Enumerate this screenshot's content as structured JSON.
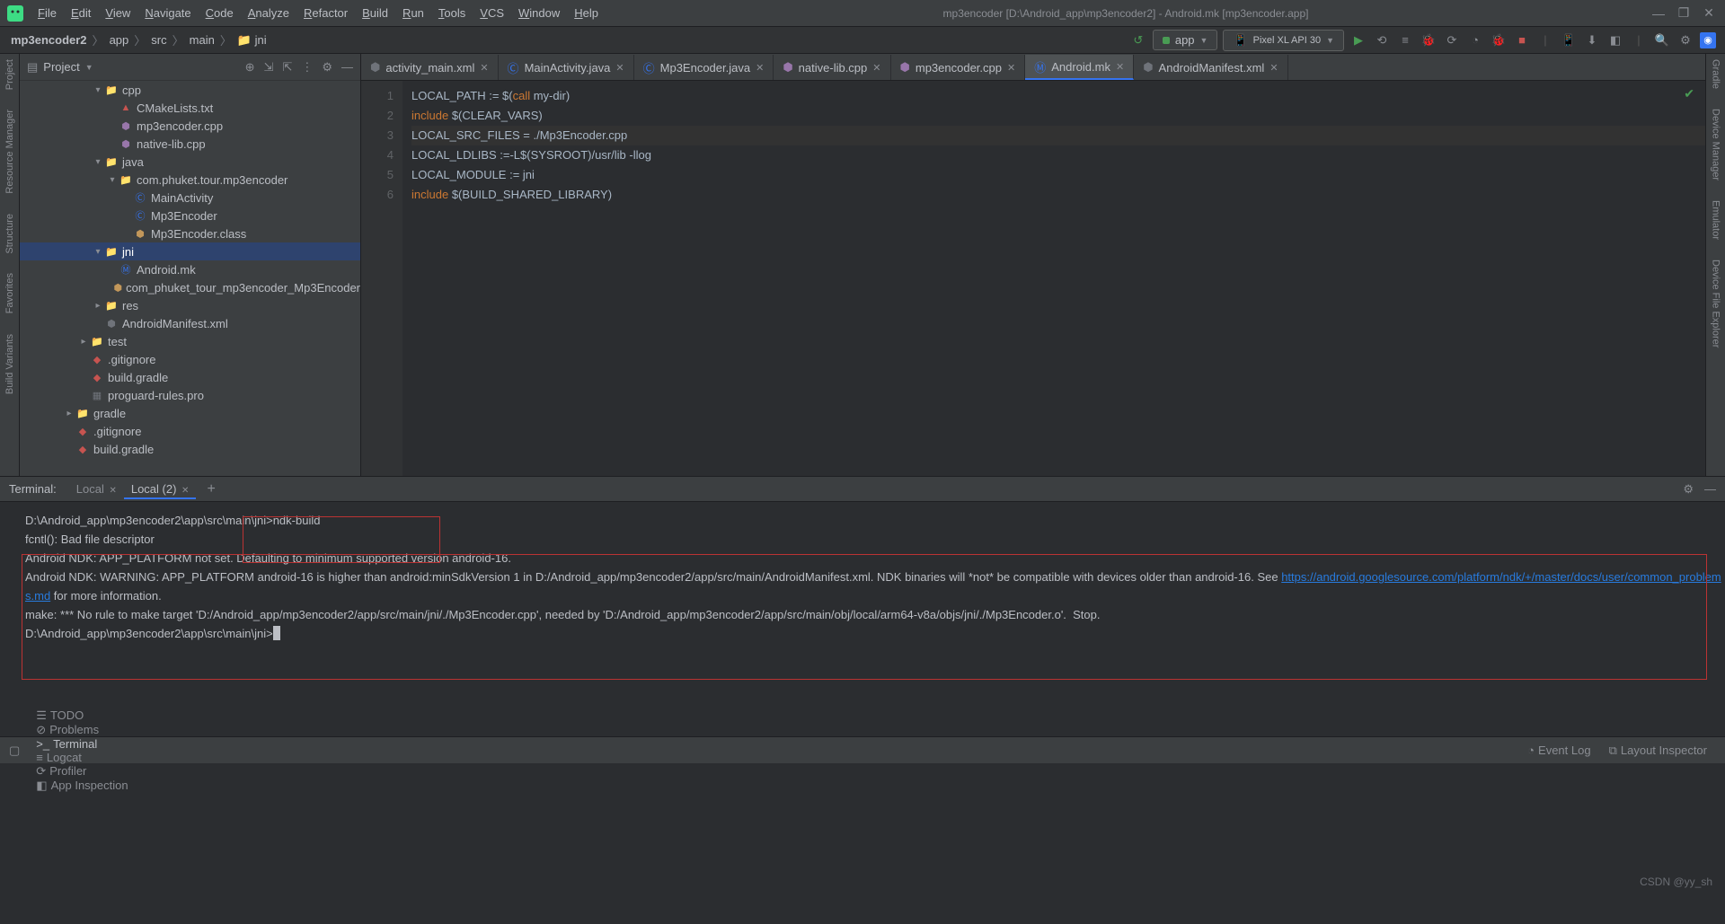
{
  "window": {
    "title": "mp3encoder [D:\\Android_app\\mp3encoder2] - Android.mk [mp3encoder.app]"
  },
  "menu": [
    "File",
    "Edit",
    "View",
    "Navigate",
    "Code",
    "Analyze",
    "Refactor",
    "Build",
    "Run",
    "Tools",
    "VCS",
    "Window",
    "Help"
  ],
  "breadcrumb": [
    "mp3encoder2",
    "app",
    "src",
    "main",
    "jni"
  ],
  "run_config": "app",
  "device": "Pixel XL API 30",
  "right_gutter": [
    "Gradle",
    "Device Manager",
    "Emulator",
    "Device File Explorer"
  ],
  "left_gutter": [
    "Project",
    "Resource Manager",
    "Structure",
    "Favorites",
    "Build Variants"
  ],
  "project_panel_title": "Project",
  "tree": [
    {
      "indent": 5,
      "chev": "▾",
      "icon": "📁",
      "cls": "f-folder",
      "label": "cpp"
    },
    {
      "indent": 6,
      "chev": "",
      "icon": "▲",
      "cls": "f-cmake",
      "label": "CMakeLists.txt"
    },
    {
      "indent": 6,
      "chev": "",
      "icon": "⬢",
      "cls": "f-cpp",
      "label": "mp3encoder.cpp"
    },
    {
      "indent": 6,
      "chev": "",
      "icon": "⬢",
      "cls": "f-cpp",
      "label": "native-lib.cpp"
    },
    {
      "indent": 5,
      "chev": "▾",
      "icon": "📁",
      "cls": "f-folder",
      "label": "java"
    },
    {
      "indent": 6,
      "chev": "▾",
      "icon": "📁",
      "cls": "f-folder",
      "label": "com.phuket.tour.mp3encoder"
    },
    {
      "indent": 7,
      "chev": "",
      "icon": "Ⓒ",
      "cls": "f-java-c",
      "label": "MainActivity"
    },
    {
      "indent": 7,
      "chev": "",
      "icon": "Ⓒ",
      "cls": "f-java-c",
      "label": "Mp3Encoder"
    },
    {
      "indent": 7,
      "chev": "",
      "icon": "⬢",
      "cls": "f-header",
      "label": "Mp3Encoder.class"
    },
    {
      "indent": 5,
      "chev": "▾",
      "icon": "📁",
      "cls": "f-folder",
      "label": "jni",
      "selected": true
    },
    {
      "indent": 6,
      "chev": "",
      "icon": "Ⓜ",
      "cls": "f-mk",
      "label": "Android.mk"
    },
    {
      "indent": 6,
      "chev": "",
      "icon": "⬢",
      "cls": "f-header",
      "label": "com_phuket_tour_mp3encoder_Mp3Encoder"
    },
    {
      "indent": 5,
      "chev": "▸",
      "icon": "📁",
      "cls": "f-folder",
      "label": "res"
    },
    {
      "indent": 5,
      "chev": "",
      "icon": "⬢",
      "cls": "f-xml",
      "label": "AndroidManifest.xml"
    },
    {
      "indent": 4,
      "chev": "▸",
      "icon": "📁",
      "cls": "f-folder",
      "label": "test"
    },
    {
      "indent": 4,
      "chev": "",
      "icon": "◆",
      "cls": "f-git",
      "label": ".gitignore"
    },
    {
      "indent": 4,
      "chev": "",
      "icon": "◆",
      "cls": "f-gradle",
      "label": "build.gradle"
    },
    {
      "indent": 4,
      "chev": "",
      "icon": "▦",
      "cls": "f-xml",
      "label": "proguard-rules.pro"
    },
    {
      "indent": 3,
      "chev": "▸",
      "icon": "📁",
      "cls": "f-folder",
      "label": "gradle"
    },
    {
      "indent": 3,
      "chev": "",
      "icon": "◆",
      "cls": "f-git",
      "label": ".gitignore"
    },
    {
      "indent": 3,
      "chev": "",
      "icon": "◆",
      "cls": "f-gradle",
      "label": "build.gradle"
    }
  ],
  "editor_tabs": [
    {
      "icon": "⬢",
      "cls": "f-xml",
      "label": "activity_main.xml",
      "active": false
    },
    {
      "icon": "Ⓒ",
      "cls": "f-java-c",
      "label": "MainActivity.java",
      "active": false
    },
    {
      "icon": "Ⓒ",
      "cls": "f-java-c",
      "label": "Mp3Encoder.java",
      "active": false
    },
    {
      "icon": "⬢",
      "cls": "f-cpp",
      "label": "native-lib.cpp",
      "active": false
    },
    {
      "icon": "⬢",
      "cls": "f-cpp",
      "label": "mp3encoder.cpp",
      "active": false
    },
    {
      "icon": "Ⓜ",
      "cls": "f-mk",
      "label": "Android.mk",
      "active": true
    },
    {
      "icon": "⬢",
      "cls": "f-xml",
      "label": "AndroidManifest.xml",
      "active": false
    }
  ],
  "code": {
    "lines": [
      "1",
      "2",
      "3",
      "4",
      "5",
      "6"
    ],
    "l1a": "LOCAL_PATH := ",
    "l1b": "$(",
    "l1c": "call",
    "l1d": " my-dir)",
    "l2a": "include",
    "l2b": " $(CLEAR_VARS)",
    "l3": "LOCAL_SRC_FILES = ./Mp3Encoder.cpp",
    "l4": "LOCAL_LDLIBS :=-L$(SYSROOT)/usr/lib -llog",
    "l5": "LOCAL_MODULE := jni",
    "l6a": "include",
    "l6b": " $(BUILD_SHARED_LIBRARY)"
  },
  "terminal": {
    "label": "Terminal:",
    "tabs": [
      {
        "name": "Local",
        "active": false
      },
      {
        "name": "Local (2)",
        "active": true
      }
    ],
    "lines": [
      "D:\\Android_app\\mp3encoder2\\app\\src\\main\\jni>ndk-build",
      "fcntl(): Bad file descriptor",
      "Android NDK: APP_PLATFORM not set. Defaulting to minimum supported version android-16.",
      "Android NDK: WARNING: APP_PLATFORM android-16 is higher than android:minSdkVersion 1 in D:/Android_app/mp3encoder2/app/src/main/AndroidManifest.xml. NDK binaries will *not* be compatible with devices older than android-16. See ",
      "https://android.googlesource.com/platform/ndk/+/master/docs/user/common_problems.md",
      " for more information.",
      "make: *** No rule to make target 'D:/Android_app/mp3encoder2/app/src/main/jni/./Mp3Encoder.cpp', needed by 'D:/Android_app/mp3encoder2/app/src/main/obj/local/arm64-v8a/objs/jni/./Mp3Encoder.o'.  Stop.",
      "",
      "D:\\Android_app\\mp3encoder2\\app\\src\\main\\jni>"
    ]
  },
  "statusbar": {
    "left": [
      {
        "icon": "☰",
        "label": "TODO"
      },
      {
        "icon": "⊘",
        "label": "Problems"
      },
      {
        "icon": ">_",
        "label": "Terminal",
        "active": true
      },
      {
        "icon": "≡",
        "label": "Logcat"
      },
      {
        "icon": "⟳",
        "label": "Profiler"
      },
      {
        "icon": "◧",
        "label": "App Inspection"
      }
    ],
    "right": [
      {
        "icon": "◔",
        "label": "Event Log"
      },
      {
        "icon": "⧉",
        "label": "Layout Inspector"
      }
    ]
  },
  "watermark": "CSDN @yy_sh"
}
